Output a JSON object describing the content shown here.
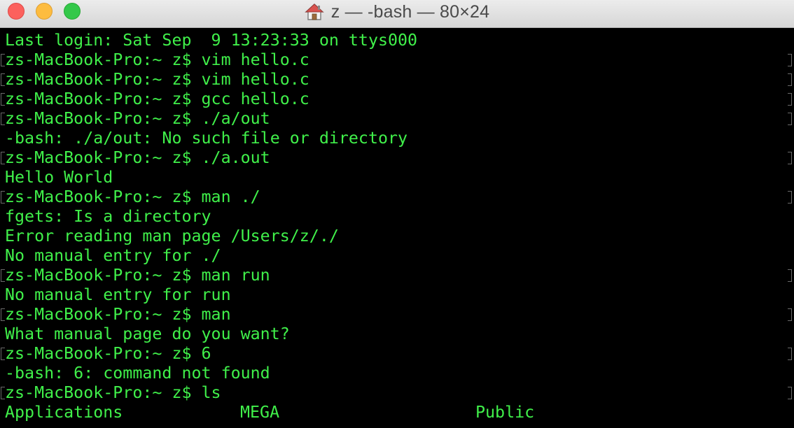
{
  "window": {
    "title": "z — -bash — 80×24",
    "title_icon": "home-icon",
    "colors": {
      "terminal_bg": "#000000",
      "terminal_fg": "#40f04a",
      "close": "#fc615d",
      "minimize": "#fdbc40",
      "zoom": "#34c84a"
    }
  },
  "terminal": {
    "lines": [
      {
        "text": "Last login: Sat Sep  9 13:23:33 on ttys000",
        "prompt": false
      },
      {
        "text": "zs-MacBook-Pro:~ z$ vim hello.c",
        "prompt": true
      },
      {
        "text": "zs-MacBook-Pro:~ z$ vim hello.c",
        "prompt": true
      },
      {
        "text": "zs-MacBook-Pro:~ z$ gcc hello.c",
        "prompt": true
      },
      {
        "text": "zs-MacBook-Pro:~ z$ ./a/out",
        "prompt": true
      },
      {
        "text": "-bash: ./a/out: No such file or directory",
        "prompt": false
      },
      {
        "text": "zs-MacBook-Pro:~ z$ ./a.out",
        "prompt": true
      },
      {
        "text": "Hello World",
        "prompt": false
      },
      {
        "text": "zs-MacBook-Pro:~ z$ man ./",
        "prompt": true
      },
      {
        "text": "fgets: Is a directory",
        "prompt": false
      },
      {
        "text": "Error reading man page /Users/z/./",
        "prompt": false
      },
      {
        "text": "No manual entry for ./",
        "prompt": false
      },
      {
        "text": "zs-MacBook-Pro:~ z$ man run",
        "prompt": true
      },
      {
        "text": "No manual entry for run",
        "prompt": false
      },
      {
        "text": "zs-MacBook-Pro:~ z$ man",
        "prompt": true
      },
      {
        "text": "What manual page do you want?",
        "prompt": false
      },
      {
        "text": "zs-MacBook-Pro:~ z$ 6",
        "prompt": true
      },
      {
        "text": "-bash: 6: command not found",
        "prompt": false
      },
      {
        "text": "zs-MacBook-Pro:~ z$ ls",
        "prompt": true
      }
    ],
    "ls_output": [
      [
        "Applications",
        "MEGA",
        "Public"
      ]
    ]
  }
}
